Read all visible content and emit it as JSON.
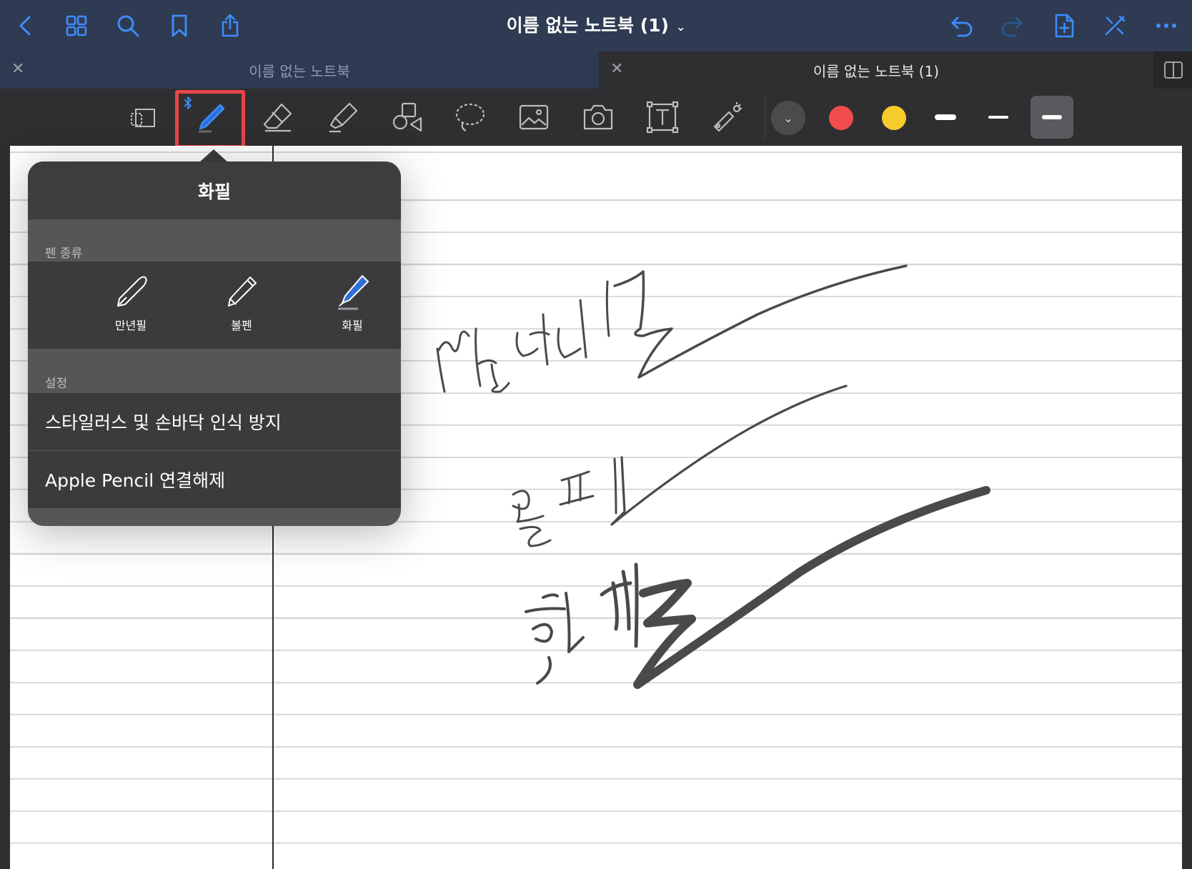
{
  "header": {
    "title": "이름 없는 노트북 (1)",
    "accent_color": "#3f8cff"
  },
  "tabs": [
    {
      "label": "이름 없는 노트북",
      "active": false
    },
    {
      "label": "이름 없는 노트북 (1)",
      "active": true
    }
  ],
  "toolbar": {
    "tools": [
      "lasso-eraser-icon",
      "pen-icon",
      "eraser-icon",
      "highlighter-icon",
      "shapes-icon",
      "lasso-icon",
      "image-icon",
      "camera-icon",
      "text-icon",
      "laser-pointer-icon"
    ],
    "selected_tool": "pen",
    "colors": [
      "#424244",
      "#f04c4c",
      "#f5cc2c"
    ],
    "selected_width": 3
  },
  "popover": {
    "title": "화필",
    "pen_type_section": "펜 종류",
    "pen_types": [
      "만년필",
      "볼펜",
      "화필"
    ],
    "selected_pen_type": "화필",
    "settings_section": "설정",
    "settings": [
      "스타일러스 및 손바닥 인식 방지",
      "Apple Pencil 연결해제"
    ]
  }
}
